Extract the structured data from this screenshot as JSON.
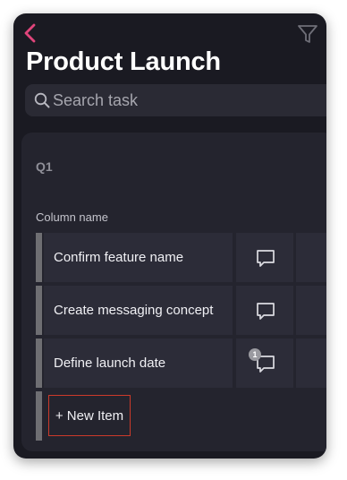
{
  "header": {
    "title": "Product Launch",
    "back_icon": "chevron-left-icon",
    "filter_icon": "filter-icon",
    "accent_color": "#e0457b"
  },
  "search": {
    "placeholder": "Search task",
    "value": ""
  },
  "board": {
    "group_label": "Q1",
    "column_label": "Column name",
    "rows": [
      {
        "name": "Confirm feature name",
        "comment_icon": "comment-icon",
        "comment_count": null
      },
      {
        "name": "Create messaging concept",
        "comment_icon": "comment-icon",
        "comment_count": null
      },
      {
        "name": "Define launch date",
        "comment_icon": "comment-icon",
        "comment_count": "1"
      }
    ],
    "new_item_label": "+ New Item"
  }
}
